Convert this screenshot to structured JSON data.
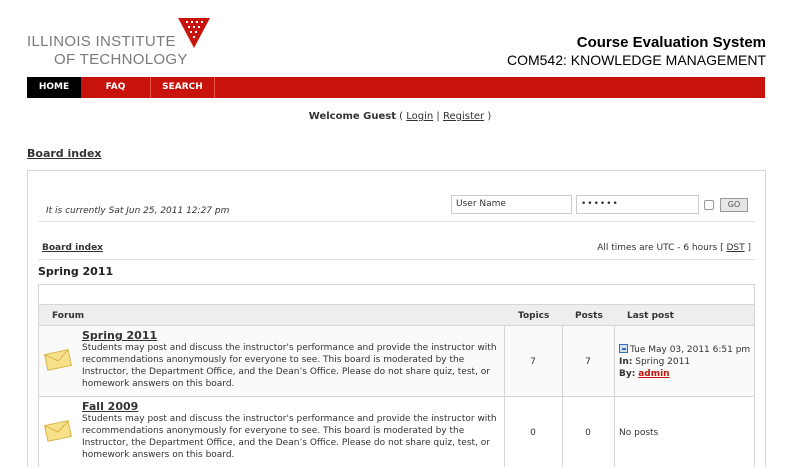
{
  "header": {
    "logo_line1": "ILLINOIS INSTITUTE",
    "logo_line2": "OF TECHNOLOGY",
    "site_title": "Course Evaluation System",
    "site_subtitle": "COM542: KNOWLEDGE MANAGEMENT"
  },
  "nav": {
    "home": "HOME",
    "faq": "FAQ",
    "search": "SEARCH"
  },
  "welcome": {
    "greeting": "Welcome Guest",
    "open": " ( ",
    "login": "Login",
    "sep": " | ",
    "register": "Register",
    "close": " )"
  },
  "breadcrumb": "Board index",
  "panel": {
    "current_time": "It is currently Sat Jun 25, 2011 12:27 pm",
    "username_value": "User Name",
    "password_value": "••••••",
    "go_label": "GO",
    "board_index": "Board index",
    "timezone_prefix": "All times are UTC - 6 hours [ ",
    "timezone_dst": "DST",
    "timezone_suffix": " ]"
  },
  "category": "Spring 2011",
  "table": {
    "headers": {
      "forum": "Forum",
      "topics": "Topics",
      "posts": "Posts",
      "last_post": "Last post"
    },
    "rows": [
      {
        "title": "Spring 2011",
        "description": "Students may post and discuss the instructor's performance and provide the instructor with recommendations anonymously for everyone to see. This board is moderated by the Instructor, the Department Office, and the Dean’s Office. Please do not share quiz, test, or homework answers on this board.",
        "topics": "7",
        "posts": "7",
        "last_post_date": "Tue May 03, 2011 6:51 pm",
        "last_post_in_label": "In:",
        "last_post_in": "Spring 2011",
        "last_post_by_label": "By:",
        "last_post_by": "admin"
      },
      {
        "title": "Fall 2009",
        "description": "Students may post and discuss the instructor's performance and provide the instructor with recommendations anonymously for everyone to see. This board is moderated by the Instructor, the Department Office, and the Dean’s Office. Please do not share quiz, test, or homework answers on this board.",
        "topics": "0",
        "posts": "0",
        "no_posts": "No posts"
      }
    ]
  },
  "colors": {
    "brand_red": "#c8120c",
    "nav_active": "#000000",
    "envelope": "#f7e08a"
  },
  "icons": {
    "logo": "iit-logo-icon",
    "forum_read": "envelope-icon",
    "view_latest": "latest-post-icon"
  }
}
